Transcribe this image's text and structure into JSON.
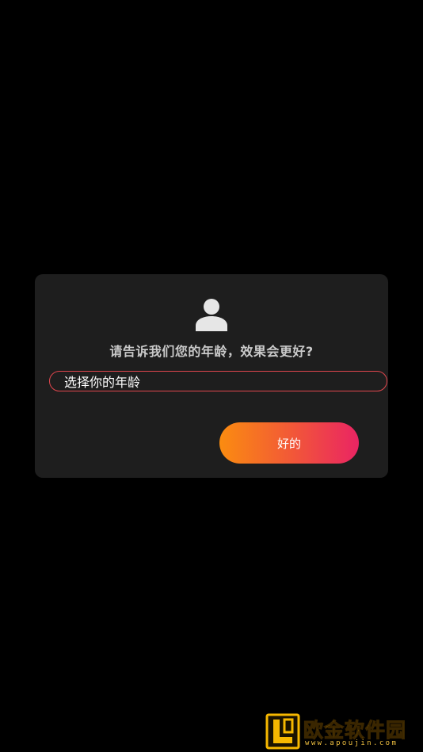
{
  "dialog": {
    "icon": "person-icon",
    "question": "请告诉我们您的年龄，效果会更好?",
    "age_field_value": "选择你的年龄",
    "ok_label": "好的"
  },
  "watermark": {
    "title": "欧金软件园",
    "url": "www.apoujin.com"
  },
  "colors": {
    "background": "#000000",
    "dialog_background": "#1e1e1e",
    "field_border": "#e0464d",
    "button_gradient_start": "#fb8c10",
    "button_gradient_end": "#ea2463",
    "question_text": "#c9c9c9"
  }
}
